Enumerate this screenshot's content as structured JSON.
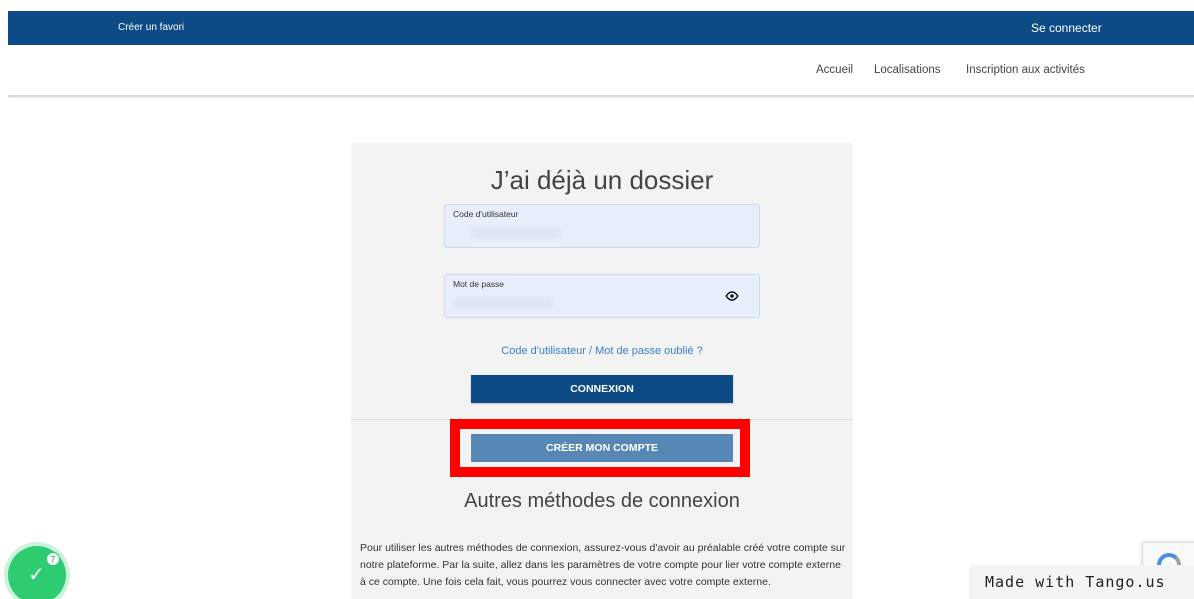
{
  "topbar": {
    "favorite_link": "Créer un favori",
    "login_link": "Se connecter"
  },
  "nav": {
    "items": [
      {
        "label": "Accueil"
      },
      {
        "label": "Localisations"
      },
      {
        "label": "Inscription aux activités"
      }
    ]
  },
  "login": {
    "title": "J’ai déjà un dossier",
    "username_label": "Code d'utilisateur",
    "password_label": "Mot de passe",
    "forgot_link": "Code d'utilisateur / Mot de passe oublié ?",
    "connect_button": "CONNEXION",
    "create_account_button": "CRÉER MON COMPTE",
    "other_methods_title": "Autres méthodes de connexion",
    "other_methods_text": "Pour utiliser les autres méthodes de connexion, assurez-vous d'avoir au préalable créé votre compte sur notre plateforme. Par la suite, allez dans les paramètres de votre compte pour lier votre compte externe à ce compte. Une fois cela fait, vous pourrez vous connecter avec votre compte externe."
  },
  "badge": {
    "count": "7",
    "icon": "check-icon"
  },
  "watermark": "Made with Tango.us",
  "colors": {
    "primary": "#0d4b86",
    "secondary_button": "#5787b5",
    "highlight": "#ff0000",
    "link": "#3a7fc6",
    "badge": "#2ecc71"
  }
}
